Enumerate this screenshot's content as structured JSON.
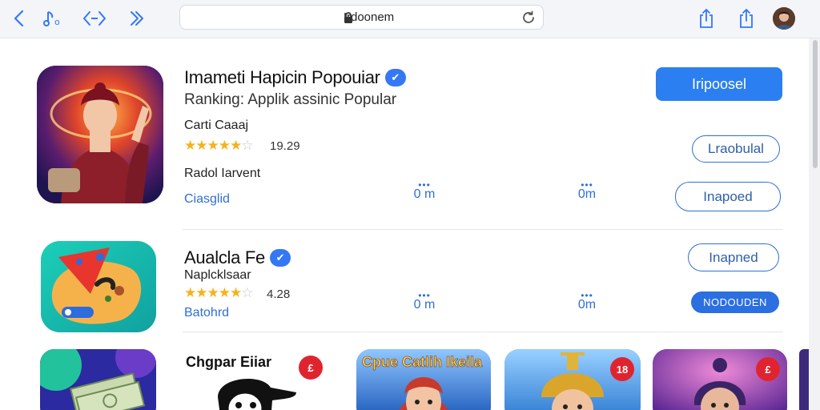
{
  "browser": {
    "url": "Irdoonem"
  },
  "apps": [
    {
      "title": "Imameti Hapicin Popouiar",
      "subtitle": "Ranking: Applik assinic Popular",
      "developer": "Carti Caaaj",
      "rating_value": "19.29",
      "stars_filled": 4.5,
      "detail_label": "Radol Iarvent",
      "link_label": "Ciasglid",
      "stat_a": "0 m",
      "stat_b": "0m",
      "get_label": "Iripoosel",
      "outline_a_label": "Lraobulal",
      "outline_b_label": "Inapoed"
    },
    {
      "title": "Aualcla Fe",
      "subtitle": "Naplcklsaar",
      "rating_value": "4.28",
      "stars_filled": 4.5,
      "link_label": "Batohrd",
      "stat_a": "0 m",
      "stat_b": "0m",
      "outline_label": "Inapned",
      "filled_label": "NODOUDEN"
    }
  ],
  "carousel": {
    "tile_2_title": "Chgpar Eiiar",
    "tile_2_badge": "£",
    "tile_3_title": "Cpue Catlih Ikeila",
    "tile_4_badge": "18",
    "tile_5_badge": "£"
  },
  "colors": {
    "accent": "#2b7ff0",
    "link": "#2f6fd6",
    "star": "#f6b21b",
    "badge": "#e0242f"
  }
}
